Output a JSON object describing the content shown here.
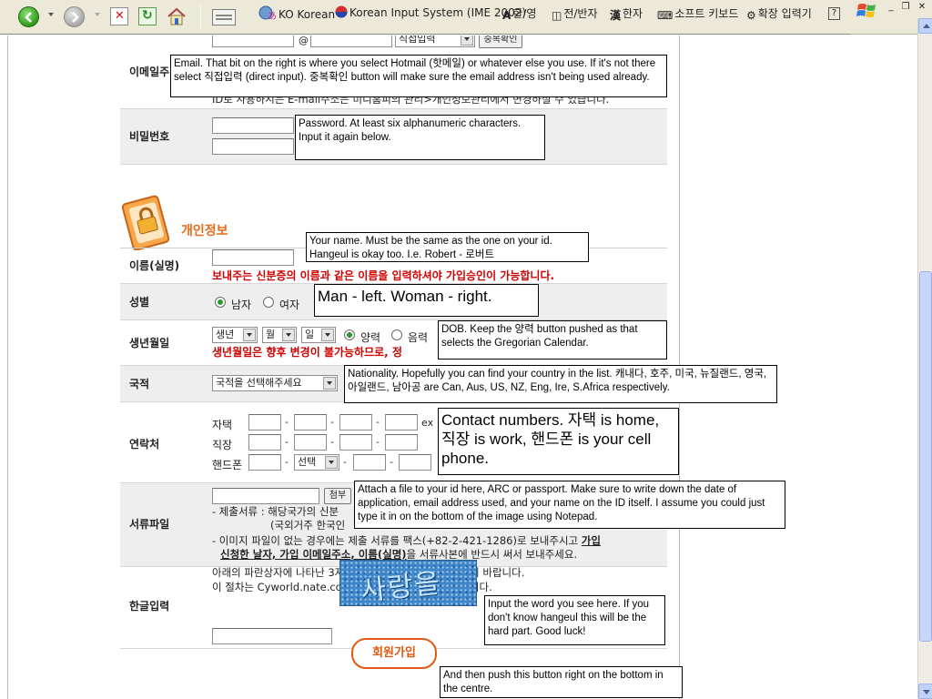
{
  "toolbar": {
    "ime": {
      "language": "KO Korean",
      "system": "Korean Input System (IME 2002)",
      "hanyoung": "한/영",
      "fullhalf": "전/반자",
      "hanja": "한자",
      "softkeyboard": "소프트 키보드",
      "extended": "확장 입력기"
    }
  },
  "form": {
    "email": {
      "label": "이메일주",
      "at": "@",
      "direct_input": "직접입력",
      "check_button": "중복확인",
      "notice": "ID로 사용하시는 E-mail주소는 미니홈피의 관리>개인정보관리에서 변경하실 수 있습니다."
    },
    "password": {
      "label": "비밀번호"
    },
    "section_title": "개인정보",
    "name": {
      "label": "이름(실명)",
      "warning": "보내주는 신분증의 이름과 같은 이름을 입력하셔야 가입승인이 가능합니다."
    },
    "gender": {
      "label": "성별",
      "male": "남자",
      "female": "여자"
    },
    "birth": {
      "label": "생년월일",
      "year": "생년",
      "month": "월",
      "day": "일",
      "solar": "양력",
      "lunar": "음력",
      "warning": "생년월일은 향후 변경이 불가능하므로, 정"
    },
    "nationality": {
      "label": "국적",
      "placeholder": "국적을 선택해주세요"
    },
    "contact": {
      "label": "연락처",
      "home": "자택",
      "work": "직장",
      "mobile": "핸드폰",
      "ex": "ex",
      "carrier": "선택",
      "dash": "-"
    },
    "document": {
      "label": "서류파일",
      "attach": "첨부",
      "line1": "- 제출서류 : 해당국가의 신분",
      "line2": "(국외거주 한국인",
      "line3_a": "- 이미지 파일이 없는 경우에는 제출 서류를 팩스(+82-2-421-1286)로 보내주시고 ",
      "line3_b": "가입",
      "line4": "신청한 날자, 가입 이메일주소, 이름(실명)",
      "line4_tail": "을 서류사본에 반드시 써서 보내주세요."
    },
    "captcha": {
      "label": "한글입력",
      "line1": "아래의 파란상자에 나타난 3자리 한글을 입력창에 넣어주시기 바랍니다.",
      "line2": "이 절차는 Cyworld.nate.com ID의 자동생성을 방지해줍니다.",
      "word": "사랑을"
    },
    "signup_button": "회원가입"
  },
  "notes": {
    "email": "Email. That bit on the right is where you select Hotmail (핫메일) or whatever else you use. If it's not there select 직접입력 (direct input). 중복확인 button will make sure the email address isn't being used already.",
    "password": "Password. At least six alphanumeric characters. Input it again below.",
    "name": "Your name. Must be the same as the one on your id. Hangeul is okay too. I.e. Robert - 로버트",
    "gender": "Man - left. Woman - right.",
    "dob": "DOB. Keep the 양력 button pushed as that selects the Gregorian Calendar.",
    "nationality": "Nationality. Hopefully you can find your country in the list. 캐내다, 호주, 미국, 뉴질랜드, 영국, 아일랜드, 남아공 are Can, Aus, US, NZ, Eng, Ire, S.Africa respectively.",
    "contact": "Contact numbers. 자택 is home, 직장 is work, 핸드폰 is your cell phone.",
    "document": "Attach a file to your id here, ARC or passport. Make sure to write down the date of application, email address used, and your name on the ID itself. I assume you could just type it in on the bottom of the image using Notepad.",
    "captcha": "Input the word you see here. If you don't know hangeul this will be the hard part. Good luck!",
    "signup": "And then push this button right on the bottom in the centre."
  },
  "colors": {
    "accent_orange": "#e66a1a",
    "warning_red": "#d00000",
    "row_gray": "#eeeeee"
  }
}
